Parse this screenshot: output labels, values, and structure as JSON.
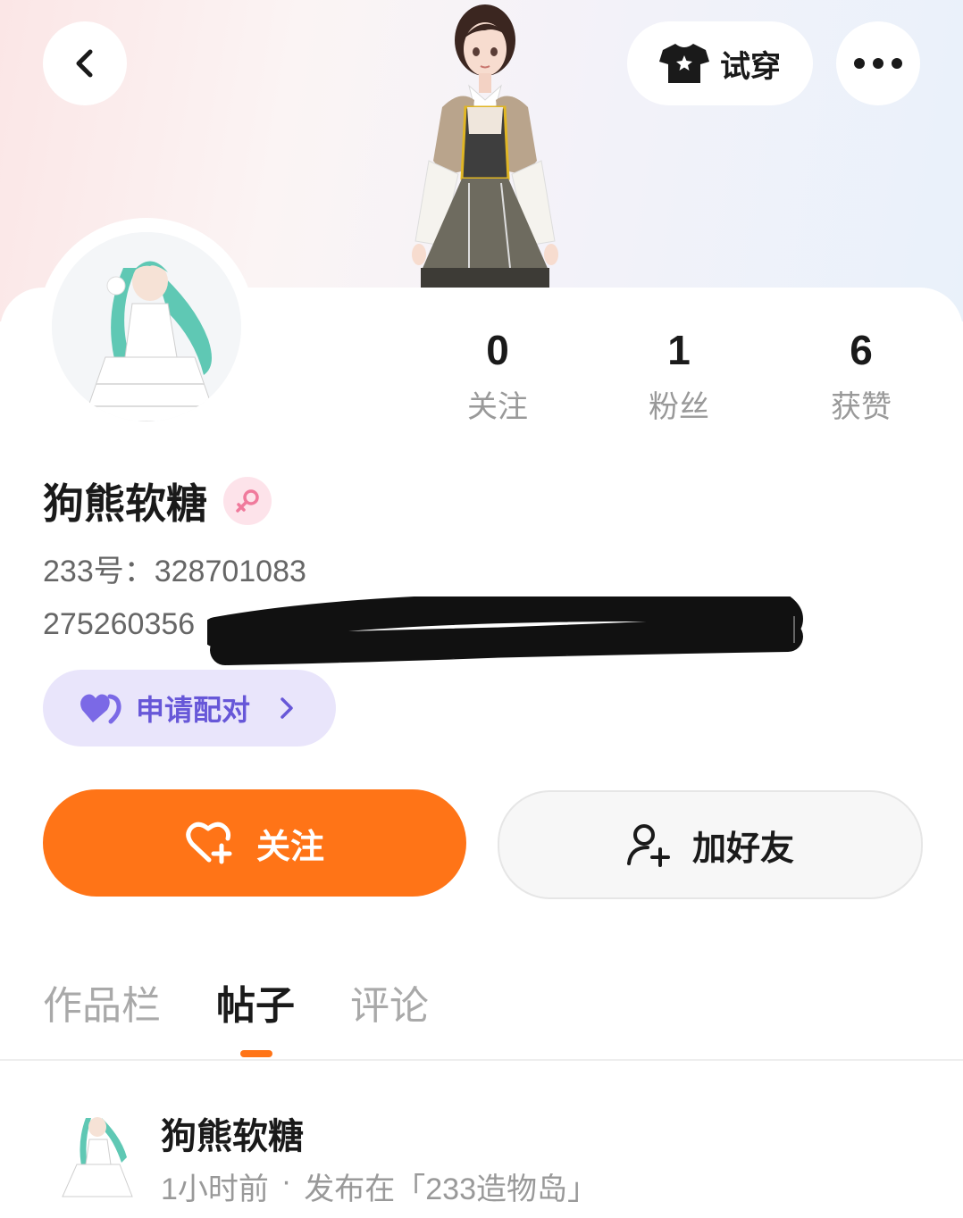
{
  "header": {
    "back_icon": "chevron-left-icon",
    "try_on_label": "试穿",
    "try_on_icon": "tshirt-icon",
    "more_icon": "more-icon"
  },
  "profile": {
    "name": "狗熊软糖",
    "gender_icon": "female-icon",
    "uid_text": "233号：328701083",
    "bio_visible": "275260356"
  },
  "stats": [
    {
      "value": "0",
      "label": "关注"
    },
    {
      "value": "1",
      "label": "粉丝"
    },
    {
      "value": "6",
      "label": "获赞"
    }
  ],
  "pair_button": {
    "label": "申请配对",
    "icon": "double-heart-icon"
  },
  "actions": {
    "follow_label": "关注",
    "follow_icon": "heart-plus-icon",
    "add_friend_label": "加好友",
    "add_friend_icon": "user-plus-icon"
  },
  "tabs": [
    {
      "label": "作品栏",
      "active": false
    },
    {
      "label": "帖子",
      "active": true
    },
    {
      "label": "评论",
      "active": false
    }
  ],
  "post": {
    "author": "狗熊软糖",
    "time": "1小时前",
    "separator": "·",
    "location": "发布在「233造物岛」"
  },
  "colors": {
    "accent": "#ff7417",
    "pair_bg": "#e9e5fb",
    "pair_text": "#6757d8",
    "gender_bg": "#fde3ea",
    "gender_fg": "#f07a9c"
  }
}
